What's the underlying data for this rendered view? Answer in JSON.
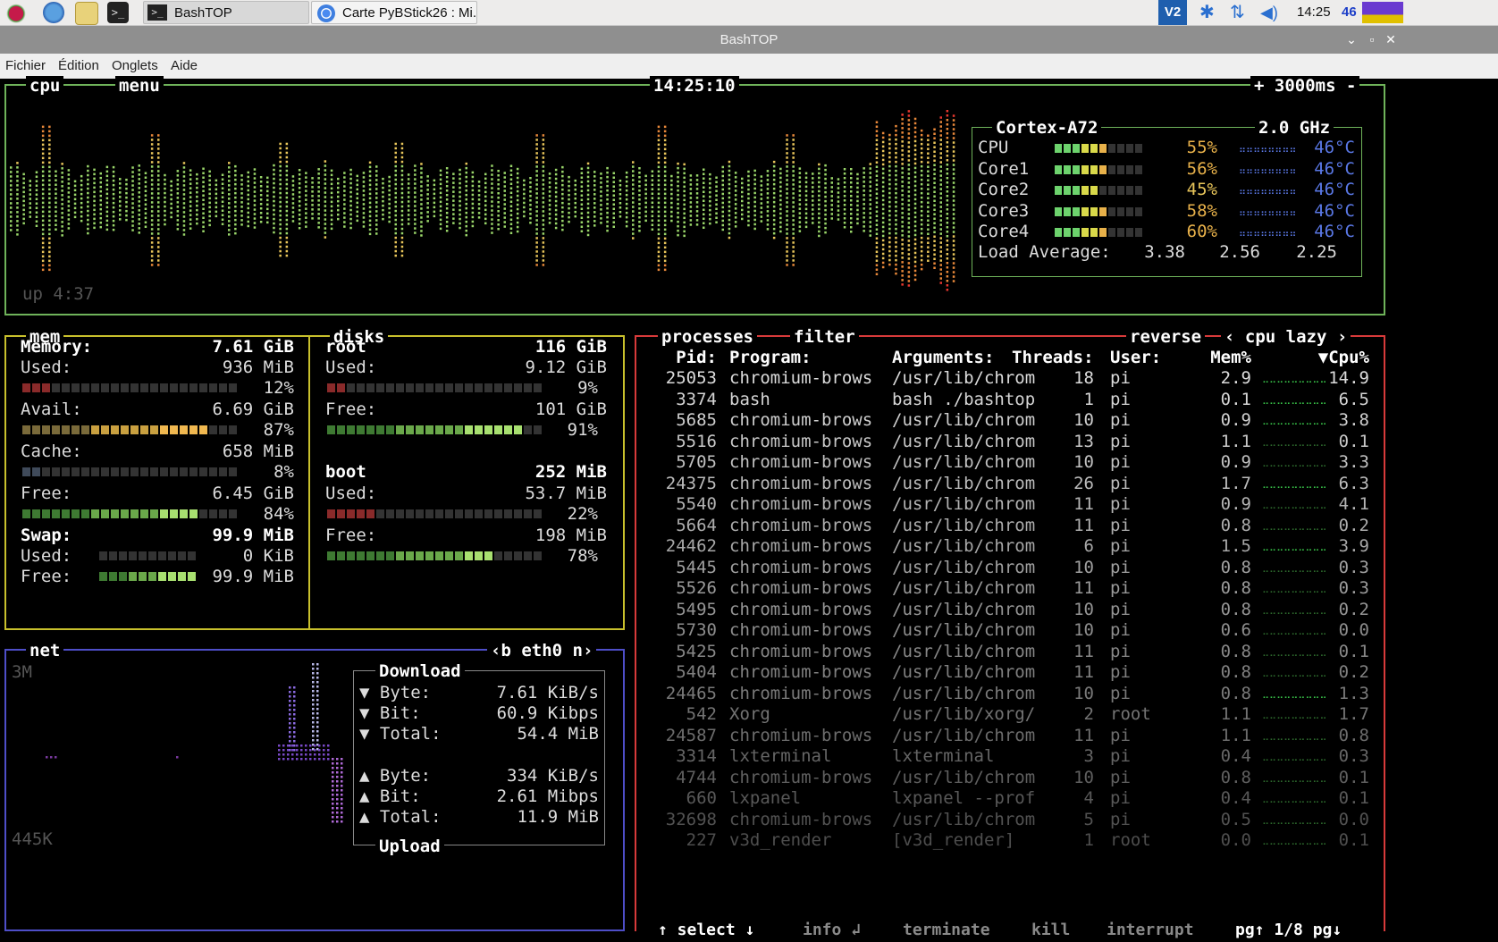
{
  "taskbar": {
    "tasks": [
      {
        "label": "BashTOP",
        "active": true
      },
      {
        "label": "Carte PyBStick26 : Mi...",
        "active": false
      }
    ],
    "clock": "14:25",
    "temp_badge": "46"
  },
  "window": {
    "title": "BashTOP",
    "menu": [
      "Fichier",
      "Édition",
      "Onglets",
      "Aide"
    ]
  },
  "cpu_box": {
    "label": "cpu",
    "menu_label": "menu",
    "clock": "14:25:10",
    "interval": "+ 3000ms -",
    "uptime": "up 4:37",
    "model": "Cortex-A72",
    "freq": "2.0 GHz",
    "cores": [
      {
        "name": "CPU",
        "pct": "55%",
        "value": 55,
        "temp": "46°C"
      },
      {
        "name": "Core1",
        "pct": "56%",
        "value": 56,
        "temp": "46°C"
      },
      {
        "name": "Core2",
        "pct": "45%",
        "value": 45,
        "temp": "46°C"
      },
      {
        "name": "Core3",
        "pct": "58%",
        "value": 58,
        "temp": "46°C"
      },
      {
        "name": "Core4",
        "pct": "60%",
        "value": 60,
        "temp": "46°C"
      }
    ],
    "load_label": "Load Average:",
    "load": [
      "3.38",
      "2.56",
      "2.25"
    ]
  },
  "mem_box": {
    "label": "mem",
    "memory_label": "Memory:",
    "memory_total": "7.61 GiB",
    "used_label": "Used:",
    "used": "936 MiB",
    "used_pct": "12%",
    "used_value": 12,
    "avail_label": "Avail:",
    "avail": "6.69 GiB",
    "avail_pct": "87%",
    "avail_value": 87,
    "cache_label": "Cache:",
    "cache": "658 MiB",
    "cache_pct": "8%",
    "cache_value": 8,
    "free_label": "Free:",
    "free": "6.45 GiB",
    "free_pct": "84%",
    "free_value": 84,
    "swap_label": "Swap:",
    "swap_total": "99.9 MiB",
    "swap_used_label": "Used:",
    "swap_used": "0 KiB",
    "swap_used_value": 0,
    "swap_free_label": "Free:",
    "swap_free": "99.9 MiB",
    "swap_free_value": 100
  },
  "disks_box": {
    "label": "disks",
    "disks": [
      {
        "name": "root",
        "total": "116 GiB",
        "used_label": "Used:",
        "used": "9.12 GiB",
        "used_pct": "9%",
        "used_value": 9,
        "free_label": "Free:",
        "free": "101 GiB",
        "free_pct": "91%",
        "free_value": 91
      },
      {
        "name": "boot",
        "total": "252 MiB",
        "used_label": "Used:",
        "used": "53.7 MiB",
        "used_pct": "22%",
        "used_value": 22,
        "free_label": "Free:",
        "free": "198 MiB",
        "free_pct": "78%",
        "free_value": 78
      }
    ]
  },
  "net_box": {
    "label": "net",
    "iface": "‹b eth0 n›",
    "scale_top": "3M",
    "scale_bottom": "445K",
    "download_label": "Download",
    "upload_label": "Upload",
    "down": [
      {
        "label": "▼ Byte:",
        "value": "7.61 KiB/s"
      },
      {
        "label": "▼ Bit:",
        "value": "60.9 Kibps"
      },
      {
        "label": "▼ Total:",
        "value": "54.4 MiB"
      }
    ],
    "up": [
      {
        "label": "▲ Byte:",
        "value": "334 KiB/s"
      },
      {
        "label": "▲ Bit:",
        "value": "2.61 Mibps"
      },
      {
        "label": "▲ Total:",
        "value": "11.9 MiB"
      }
    ]
  },
  "proc_box": {
    "label": "processes",
    "filter_label": "filter",
    "reverse_label": "reverse",
    "sort_label": "‹ cpu lazy ›",
    "headers": {
      "pid": "Pid:",
      "program": "Program:",
      "args": "Arguments:",
      "threads": "Threads:",
      "user": "User:",
      "mem": "Mem%",
      "cpu": "▼Cpu%"
    },
    "rows": [
      {
        "pid": "25053",
        "program": "chromium-brows",
        "args": "/usr/lib/chrom",
        "threads": "18",
        "user": "pi",
        "mem": "2.9",
        "cpu": "14.9"
      },
      {
        "pid": "3374",
        "program": "bash",
        "args": "bash ./bashtop",
        "threads": "1",
        "user": "pi",
        "mem": "0.1",
        "cpu": "6.5"
      },
      {
        "pid": "5685",
        "program": "chromium-brows",
        "args": "/usr/lib/chrom",
        "threads": "10",
        "user": "pi",
        "mem": "0.9",
        "cpu": "3.8"
      },
      {
        "pid": "5516",
        "program": "chromium-brows",
        "args": "/usr/lib/chrom",
        "threads": "13",
        "user": "pi",
        "mem": "1.1",
        "cpu": "0.1"
      },
      {
        "pid": "5705",
        "program": "chromium-brows",
        "args": "/usr/lib/chrom",
        "threads": "10",
        "user": "pi",
        "mem": "0.9",
        "cpu": "3.3"
      },
      {
        "pid": "24375",
        "program": "chromium-brows",
        "args": "/usr/lib/chrom",
        "threads": "26",
        "user": "pi",
        "mem": "1.7",
        "cpu": "6.3"
      },
      {
        "pid": "5540",
        "program": "chromium-brows",
        "args": "/usr/lib/chrom",
        "threads": "11",
        "user": "pi",
        "mem": "0.9",
        "cpu": "4.1"
      },
      {
        "pid": "5664",
        "program": "chromium-brows",
        "args": "/usr/lib/chrom",
        "threads": "11",
        "user": "pi",
        "mem": "0.8",
        "cpu": "0.2"
      },
      {
        "pid": "24462",
        "program": "chromium-brows",
        "args": "/usr/lib/chrom",
        "threads": "6",
        "user": "pi",
        "mem": "1.5",
        "cpu": "3.9"
      },
      {
        "pid": "5445",
        "program": "chromium-brows",
        "args": "/usr/lib/chrom",
        "threads": "10",
        "user": "pi",
        "mem": "0.8",
        "cpu": "0.3"
      },
      {
        "pid": "5526",
        "program": "chromium-brows",
        "args": "/usr/lib/chrom",
        "threads": "11",
        "user": "pi",
        "mem": "0.8",
        "cpu": "0.3"
      },
      {
        "pid": "5495",
        "program": "chromium-brows",
        "args": "/usr/lib/chrom",
        "threads": "10",
        "user": "pi",
        "mem": "0.8",
        "cpu": "0.2"
      },
      {
        "pid": "5730",
        "program": "chromium-brows",
        "args": "/usr/lib/chrom",
        "threads": "10",
        "user": "pi",
        "mem": "0.6",
        "cpu": "0.0"
      },
      {
        "pid": "5425",
        "program": "chromium-brows",
        "args": "/usr/lib/chrom",
        "threads": "11",
        "user": "pi",
        "mem": "0.8",
        "cpu": "0.1"
      },
      {
        "pid": "5404",
        "program": "chromium-brows",
        "args": "/usr/lib/chrom",
        "threads": "11",
        "user": "pi",
        "mem": "0.8",
        "cpu": "0.2"
      },
      {
        "pid": "24465",
        "program": "chromium-brows",
        "args": "/usr/lib/chrom",
        "threads": "10",
        "user": "pi",
        "mem": "0.8",
        "cpu": "1.3"
      },
      {
        "pid": "542",
        "program": "Xorg",
        "args": "/usr/lib/xorg/",
        "threads": "2",
        "user": "root",
        "mem": "1.1",
        "cpu": "1.7"
      },
      {
        "pid": "24587",
        "program": "chromium-brows",
        "args": "/usr/lib/chrom",
        "threads": "11",
        "user": "pi",
        "mem": "1.1",
        "cpu": "0.8"
      },
      {
        "pid": "3314",
        "program": "lxterminal",
        "args": "lxterminal",
        "threads": "3",
        "user": "pi",
        "mem": "0.4",
        "cpu": "0.3"
      },
      {
        "pid": "4744",
        "program": "chromium-brows",
        "args": "/usr/lib/chrom",
        "threads": "10",
        "user": "pi",
        "mem": "0.8",
        "cpu": "0.1"
      },
      {
        "pid": "660",
        "program": "lxpanel",
        "args": "lxpanel --prof",
        "threads": "4",
        "user": "pi",
        "mem": "0.4",
        "cpu": "0.1"
      },
      {
        "pid": "32698",
        "program": "chromium-brows",
        "args": "/usr/lib/chrom",
        "threads": "5",
        "user": "pi",
        "mem": "0.5",
        "cpu": "0.0"
      },
      {
        "pid": "227",
        "program": "v3d_render",
        "args": "[v3d_render]",
        "threads": "1",
        "user": "root",
        "mem": "0.0",
        "cpu": "0.1"
      }
    ],
    "footer": {
      "select": "↑ select ↓",
      "info": "info ↲",
      "terminate": "terminate",
      "kill": "kill",
      "interrupt": "interrupt",
      "pages": "pg↑ 1/8 pg↓"
    }
  },
  "colors": {
    "cpu_border": "#6fb35a",
    "mem_border": "#c8c02c",
    "net_border": "#4e4ec8",
    "proc_border": "#d83a3a",
    "graph_low": "#9ad66a",
    "graph_mid": "#e8c55a",
    "graph_high": "#e8372f",
    "temp": "#5a78e6"
  }
}
